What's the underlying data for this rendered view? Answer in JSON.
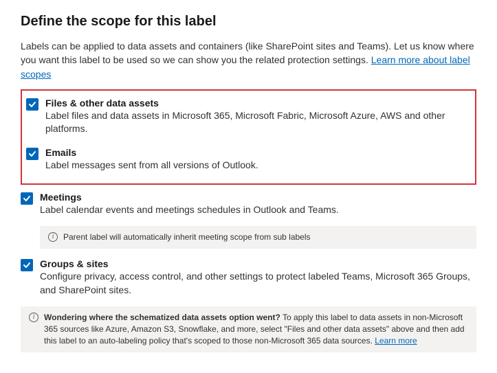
{
  "heading": "Define the scope for this label",
  "intro": {
    "text": "Labels can be applied to data assets and containers (like SharePoint sites and Teams). Let us know where you want this label to be used so we can show you the related protection settings. ",
    "link": "Learn more about label scopes"
  },
  "scopes": {
    "files": {
      "title": "Files & other data assets",
      "desc": "Label files and data assets in Microsoft 365, Microsoft Fabric, Microsoft Azure, AWS and other platforms."
    },
    "emails": {
      "title": "Emails",
      "desc": "Label messages sent from all versions of Outlook."
    },
    "meetings": {
      "title": "Meetings",
      "desc": "Label calendar events and meetings schedules in Outlook and Teams."
    },
    "groups": {
      "title": "Groups & sites",
      "desc": "Configure privacy, access control, and other settings to protect labeled Teams, Microsoft 365 Groups, and SharePoint sites."
    }
  },
  "info": {
    "meetings_note": "Parent label will automatically inherit meeting scope from sub labels",
    "schematized": {
      "bold": "Wondering where the schematized data assets option went?",
      "rest": " To apply this label to data assets in non-Microsoft 365 sources like Azure, Amazon S3, Snowflake, and more, select \"Files and other data assets\" above and then add this label to an auto-labeling policy that's scoped to those non-Microsoft 365 data sources. ",
      "link": "Learn more"
    }
  }
}
